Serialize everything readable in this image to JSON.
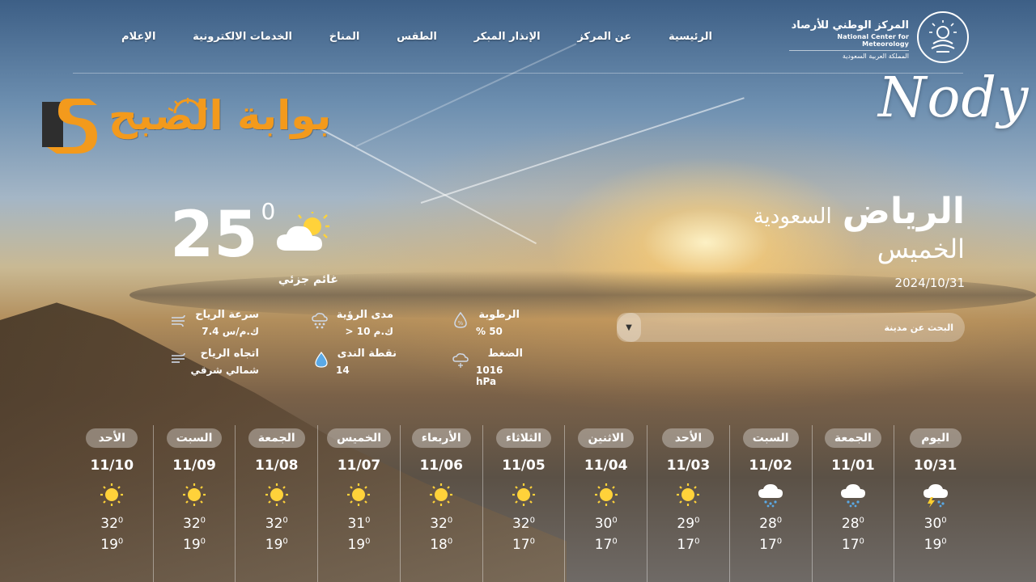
{
  "nav": {
    "items": [
      "الرئيسية",
      "عن المركز",
      "الإنذار المبكر",
      "الطقس",
      "المناخ",
      "الخدمات الالكترونية",
      "الإعلام"
    ]
  },
  "ncm": {
    "name_ar": "المركز الوطني للأرصاد",
    "name_en": "National Center for Meteorology",
    "subtitle": "المملكة العربية السعودية"
  },
  "watermark": "Nody",
  "brand": {
    "name": "بوابة الصبح",
    "colors": {
      "orange": "#f39a1c",
      "dark": "#3a3a3a"
    }
  },
  "current": {
    "city": "الرياض",
    "country": "السعودية",
    "day": "الخميس",
    "date": "2024/10/31",
    "temperature": "25",
    "degree_symbol": "0",
    "condition": "غائم جزئي",
    "icon": "partly-cloudy-icon"
  },
  "search": {
    "placeholder": "البحث عن مدينة",
    "caret": "▼"
  },
  "stats": {
    "wind_speed": {
      "label": "سرعة الرياح",
      "value": "ك.م/س 7.4",
      "icon": "wind-icon"
    },
    "wind_direction": {
      "label": "اتجاه الرياح",
      "value": "شمالي شرقي",
      "icon": "wind-direction-icon"
    },
    "visibility": {
      "label": "مدى الرؤية",
      "value": "ك.م 10 <",
      "icon": "visibility-icon"
    },
    "dew_point": {
      "label": "نقطة الندى",
      "value": "14",
      "icon": "dew-icon"
    },
    "humidity": {
      "label": "الرطوبة",
      "value": "50 %",
      "icon": "humidity-icon"
    },
    "pressure": {
      "label": "الضغط",
      "value": "1016 hPa",
      "icon": "pressure-icon"
    }
  },
  "forecast": [
    {
      "day": "اليوم",
      "date": "10/31",
      "icon": "thunder-rain-icon",
      "hi": "30",
      "lo": "19"
    },
    {
      "day": "الجمعة",
      "date": "11/01",
      "icon": "rain-cloud-icon",
      "hi": "28",
      "lo": "17"
    },
    {
      "day": "السبت",
      "date": "11/02",
      "icon": "rain-cloud-icon",
      "hi": "28",
      "lo": "17"
    },
    {
      "day": "الأحد",
      "date": "11/03",
      "icon": "sun-icon",
      "hi": "29",
      "lo": "17"
    },
    {
      "day": "الاثنين",
      "date": "11/04",
      "icon": "sun-icon",
      "hi": "30",
      "lo": "17"
    },
    {
      "day": "الثلاثاء",
      "date": "11/05",
      "icon": "sun-icon",
      "hi": "32",
      "lo": "17"
    },
    {
      "day": "الأربعاء",
      "date": "11/06",
      "icon": "sun-icon",
      "hi": "32",
      "lo": "18"
    },
    {
      "day": "الخميس",
      "date": "11/07",
      "icon": "sun-icon",
      "hi": "31",
      "lo": "19"
    },
    {
      "day": "الجمعة",
      "date": "11/08",
      "icon": "sun-icon",
      "hi": "32",
      "lo": "19"
    },
    {
      "day": "السبت",
      "date": "11/09",
      "icon": "sun-icon",
      "hi": "32",
      "lo": "19"
    },
    {
      "day": "الأحد",
      "date": "11/10",
      "icon": "sun-icon",
      "hi": "32",
      "lo": "19"
    }
  ],
  "colors": {
    "sun": "#ffd23a",
    "rain": "#5aa9e6",
    "bolt": "#ffcf2e"
  }
}
